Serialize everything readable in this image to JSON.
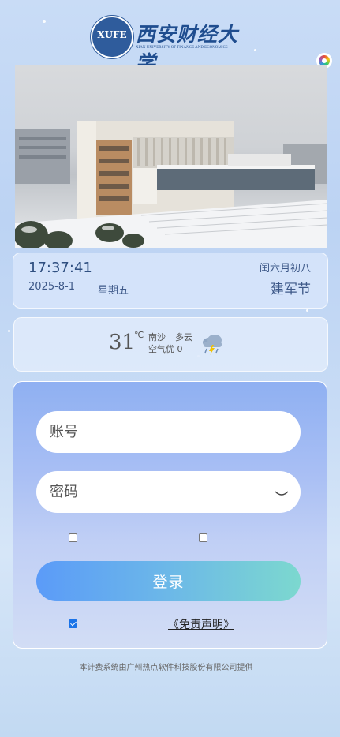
{
  "header": {
    "seal_text": "XUFE",
    "name_cn": "西安财经大学",
    "name_en": "XIAN UNIVERSITY OF FINANCE AND ECONOMICS"
  },
  "clock": {
    "time": "17:37:41",
    "date": "2025-8-1",
    "weekday": "星期五",
    "lunar": "闰六月初八",
    "festival": "建军节"
  },
  "weather": {
    "temperature": "31",
    "unit": "℃",
    "location": "南沙",
    "condition": "多云",
    "air_quality": "空气优 0",
    "icon": "thunder-rain-cloud-icon"
  },
  "login": {
    "account_placeholder": "账号",
    "password_placeholder": "密码",
    "submit_label": "登录",
    "disclaimer_label": "《免责声明》",
    "agree_checked": true
  },
  "footer": {
    "text": "本计费系统由广州热点软件科技股份有限公司提供"
  },
  "colors": {
    "brand_blue": "#1f4d8f",
    "button_gradient_start": "#5b9bf8",
    "button_gradient_end": "#7cd8cf"
  }
}
